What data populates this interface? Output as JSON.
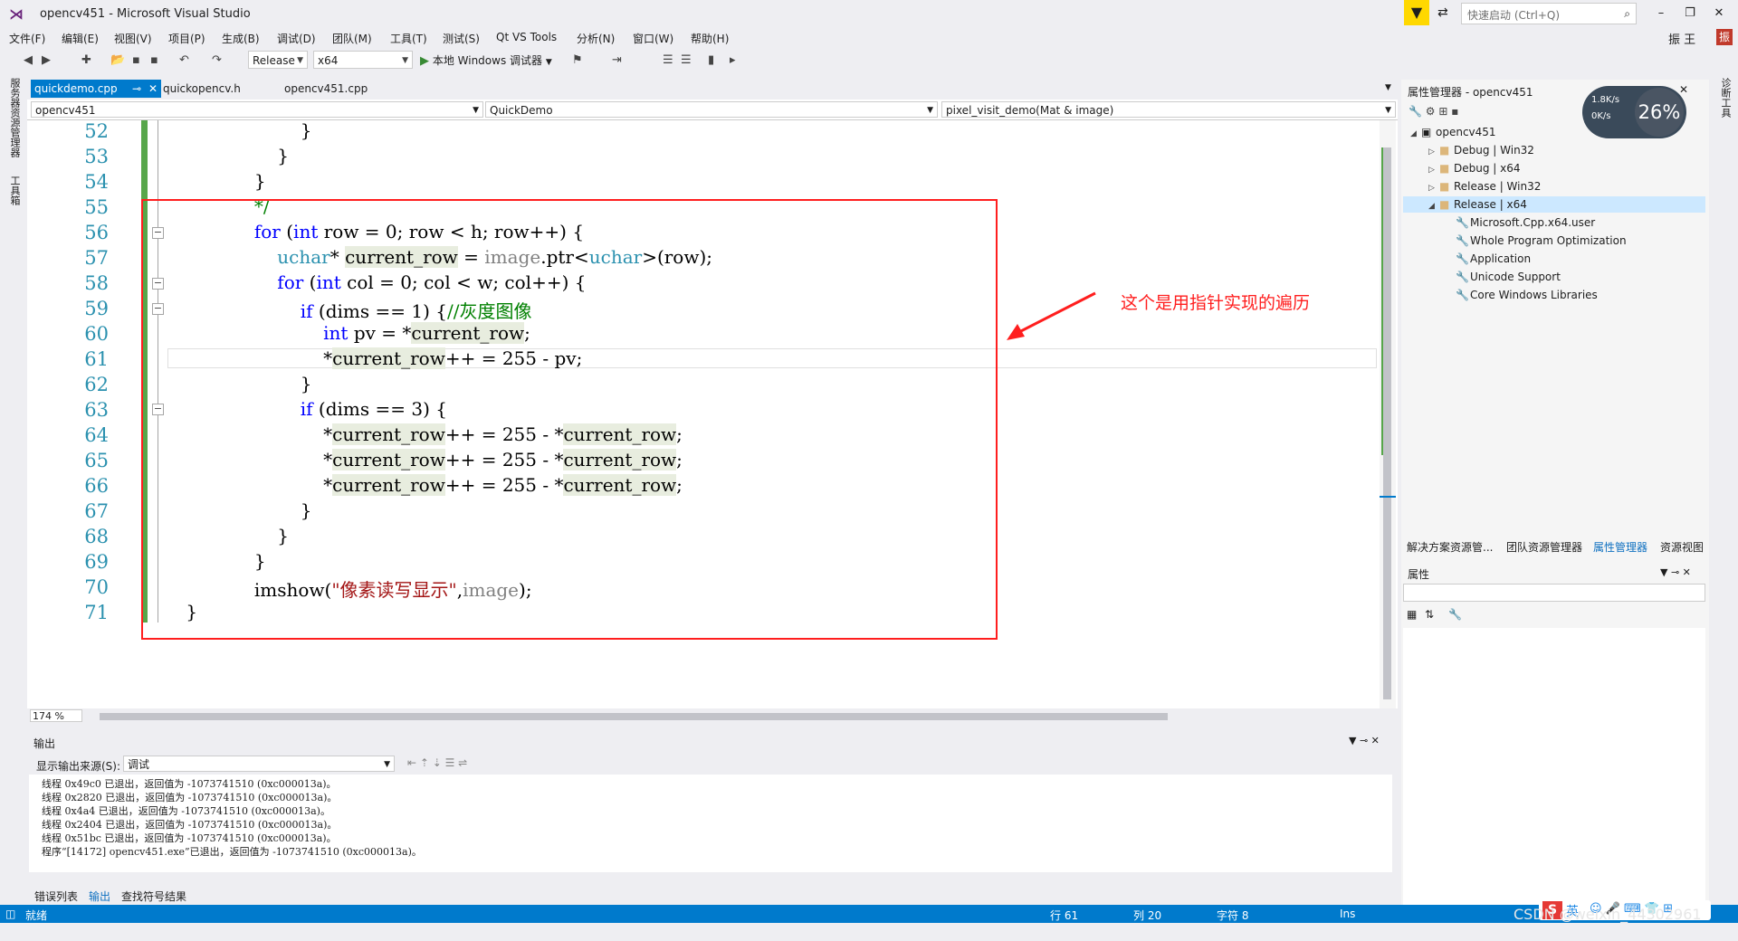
{
  "window": {
    "title": "opencv451 - Microsoft Visual Studio"
  },
  "quick_launch": {
    "placeholder": "快速启动 (Ctrl+Q)"
  },
  "menu": [
    "文件(F)",
    "编辑(E)",
    "视图(V)",
    "项目(P)",
    "生成(B)",
    "调试(D)",
    "团队(M)",
    "工具(T)",
    "测试(S)",
    "Qt VS Tools",
    "分析(N)",
    "窗口(W)",
    "帮助(H)"
  ],
  "user": {
    "name": "振 王",
    "badge": "振"
  },
  "toolbar": {
    "config": "Release",
    "platform": "x64",
    "debugger": "本地 Windows 调试器"
  },
  "doc_tabs": [
    "quickdemo.cpp",
    "quickopencv.h",
    "opencv451.cpp"
  ],
  "nav": {
    "project": "opencv451",
    "scope": "QuickDemo",
    "member": "pixel_visit_demo(Mat & image)"
  },
  "editor": {
    "line_numbers": [
      "52",
      "53",
      "54",
      "55",
      "56",
      "57",
      "58",
      "59",
      "60",
      "61",
      "62",
      "63",
      "64",
      "65",
      "66",
      "67",
      "68",
      "69",
      "70",
      "71"
    ],
    "zoom": "174 %"
  },
  "annotation": "这个是用指针实现的遍历",
  "output": {
    "title": "输出",
    "source_label": "显示输出来源(S):",
    "source_value": "调试",
    "lines": [
      "线程 0x49c0 已退出，返回值为 -1073741510 (0xc000013a)。",
      "线程 0x2820 已退出，返回值为 -1073741510 (0xc000013a)。",
      "线程 0x4a4 已退出，返回值为 -1073741510 (0xc000013a)。",
      "线程 0x2404 已退出，返回值为 -1073741510 (0xc000013a)。",
      "线程 0x51bc 已退出，返回值为 -1073741510 (0xc000013a)。",
      "程序“[14172] opencv451.exe”已退出，返回值为 -1073741510 (0xc000013a)。"
    ]
  },
  "bottom_tabs": [
    "错误列表",
    "输出",
    "查找符号结果"
  ],
  "property_manager": {
    "title": "属性管理器 - opencv451",
    "speed_up": "1.8K/s",
    "speed_down": "0K/s",
    "cpu": "26%",
    "tree": {
      "root": "opencv451",
      "configs": [
        "Debug | Win32",
        "Debug | x64",
        "Release | Win32",
        "Release | x64"
      ],
      "sheets": [
        "Microsoft.Cpp.x64.user",
        "Whole Program Optimization",
        "Application",
        "Unicode Support",
        "Core Windows Libraries"
      ]
    }
  },
  "right_tabs": [
    "解决方案资源管...",
    "团队资源管理器",
    "属性管理器",
    "资源视图"
  ],
  "properties": {
    "title": "属性"
  },
  "left_strip": [
    "服务器资源管理器",
    "工具箱"
  ],
  "right_strip": [
    "诊断工具"
  ],
  "status": {
    "ready": "就绪",
    "row": "行 61",
    "col": "列 20",
    "char": "字符 8",
    "mode": "Ins"
  },
  "watermark": "CSDN @weixin_44302961",
  "ime": {
    "lang": "英"
  }
}
